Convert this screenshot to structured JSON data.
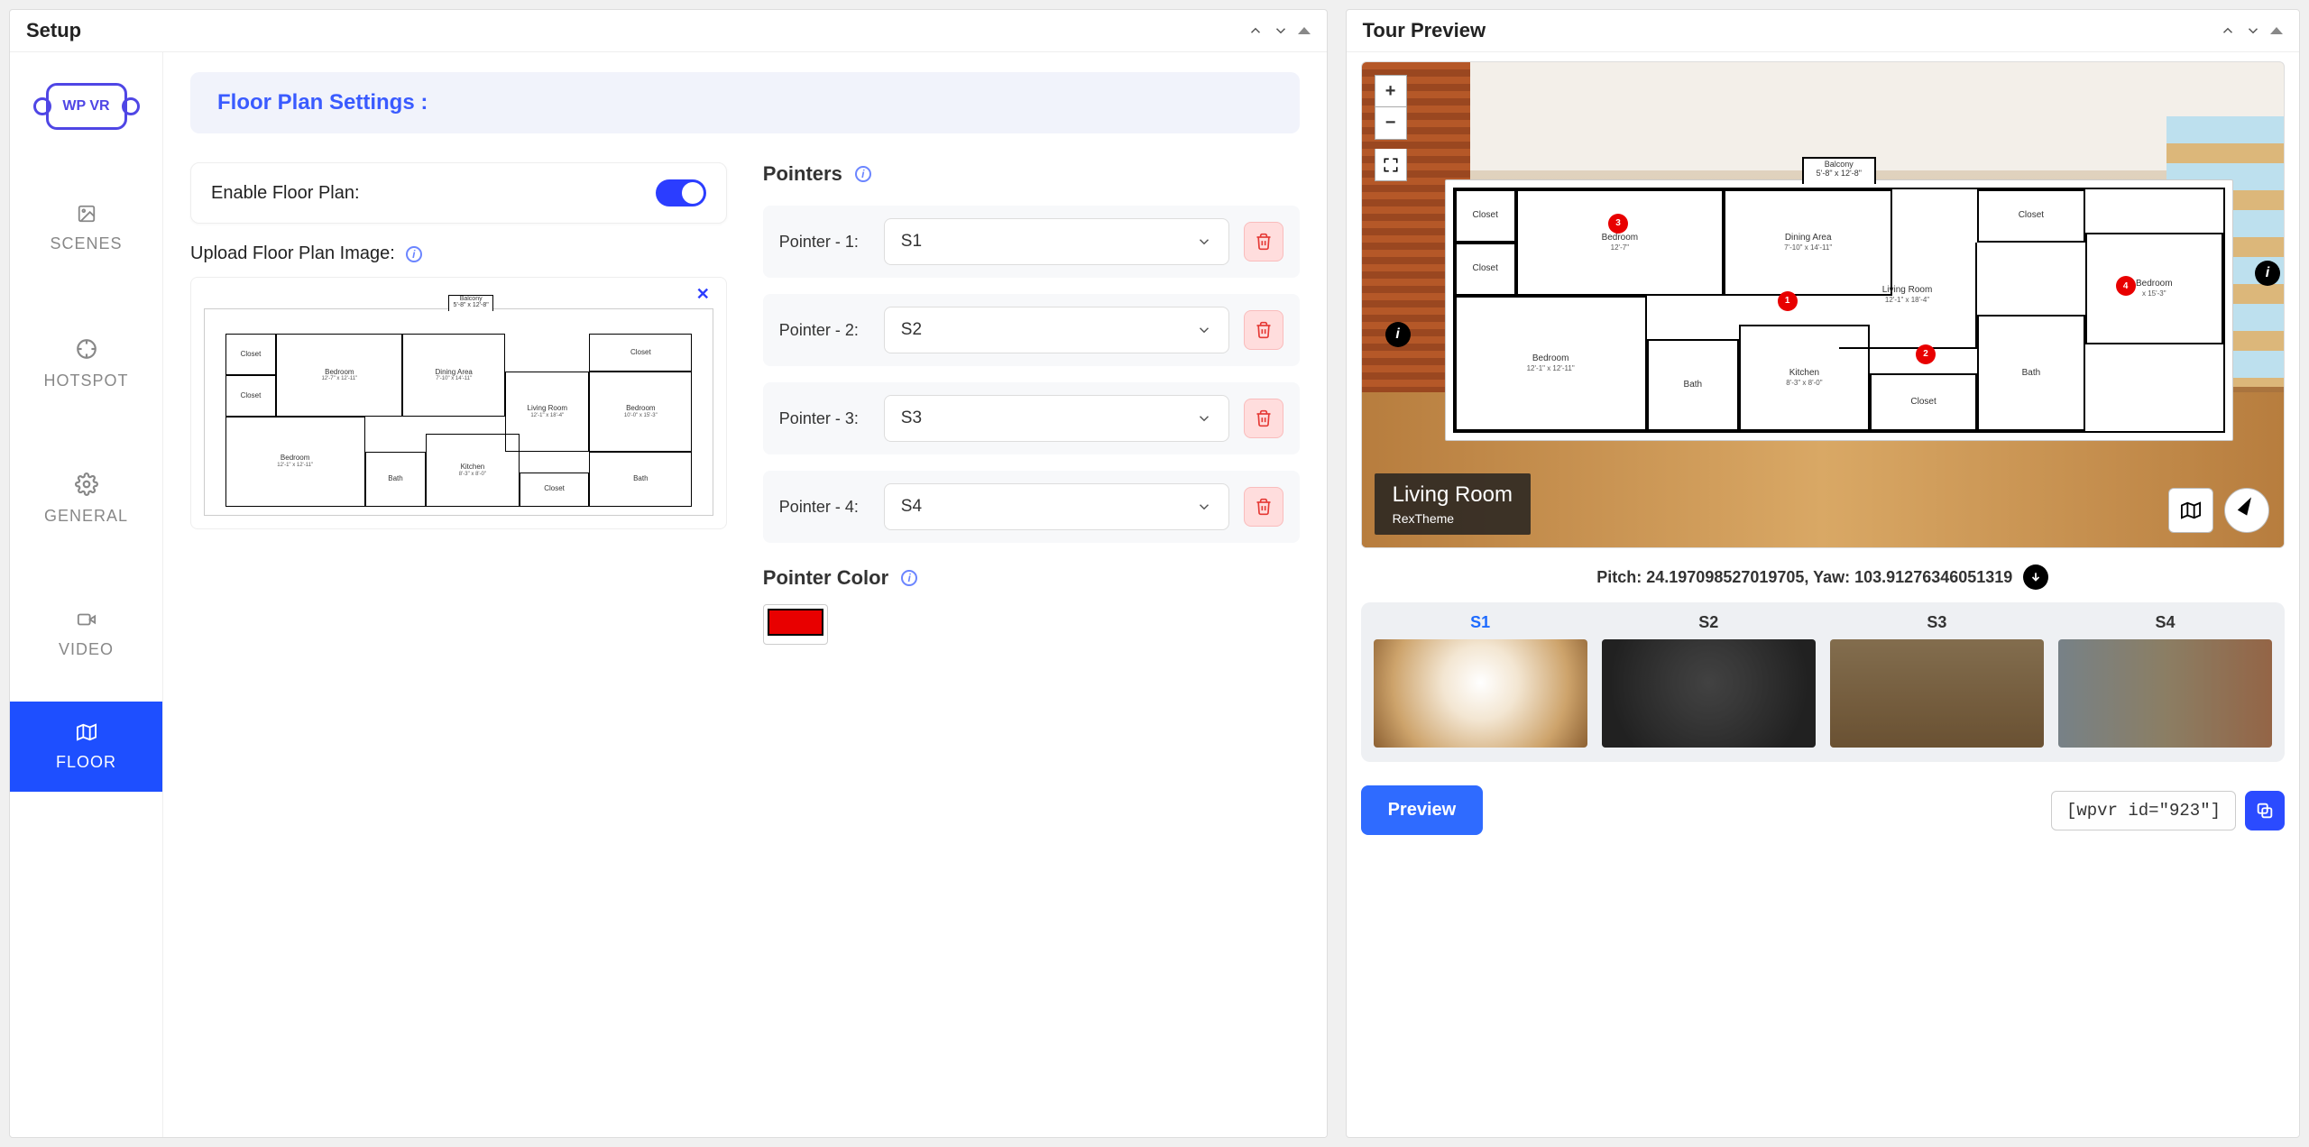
{
  "leftPanel": {
    "title": "Setup"
  },
  "rightPanel": {
    "title": "Tour Preview"
  },
  "logo": "WP VR",
  "nav": {
    "scenes": "SCENES",
    "hotspot": "HOTSPOT",
    "general": "GENERAL",
    "video": "VIDEO",
    "floor": "FLOOR"
  },
  "sectionTitle": "Floor Plan Settings :",
  "enableLabel": "Enable Floor Plan:",
  "uploadLabel": "Upload Floor Plan Image:",
  "pointersTitle": "Pointers",
  "pointers": [
    {
      "label": "Pointer - 1:",
      "value": "S1"
    },
    {
      "label": "Pointer - 2:",
      "value": "S2"
    },
    {
      "label": "Pointer - 3:",
      "value": "S3"
    },
    {
      "label": "Pointer - 4:",
      "value": "S4"
    }
  ],
  "pointerColorLabel": "Pointer Color",
  "pointerColor": "#e80000",
  "floorplanUpload": {
    "balcony": {
      "name": "Balcony",
      "dim": "5'-8\" x 12'-8\""
    },
    "rooms": {
      "closet1": "Closet",
      "closet2": "Closet",
      "bedroomTL": {
        "name": "Bedroom",
        "dim": "12'-7\" x 12'-11\""
      },
      "dining": {
        "name": "Dining Area",
        "dim": "7'-10\" x 14'-11\""
      },
      "living": {
        "name": "Living Room",
        "dim": "12'-1\" x 18'-4\""
      },
      "closetR": "Closet",
      "bedroomR": {
        "name": "Bedroom",
        "dim": "10'-0\" x 15'-3\""
      },
      "bathR": "Bath",
      "bedroomBL": {
        "name": "Bedroom",
        "dim": "12'-1\" x 12'-11\""
      },
      "bathBL": "Bath",
      "kitchen": {
        "name": "Kitchen",
        "dim": "8'-3\" x 8'-0\""
      },
      "closetBR": "Closet"
    }
  },
  "preview": {
    "floorplan": {
      "balcony": {
        "name": "Balcony",
        "dim": "5'-8\" x 12'-8\""
      },
      "rooms": {
        "closet1": "Closet",
        "closet2": "Closet",
        "bedroomTL": {
          "name": "Bedroom",
          "dim": "12'-7\""
        },
        "dining": {
          "name": "Dining Area",
          "dim": "7'-10\" x 14'-11\""
        },
        "living": {
          "name": "Living Room",
          "dim": "12'-1\" x 18'-4\""
        },
        "closetR": "Closet",
        "bedroomR": {
          "name": "Bedroom",
          "dim": "x 15'-3\""
        },
        "bathR": "Bath",
        "bedroomBL": {
          "name": "Bedroom",
          "dim": "12'-1\" x 12'-11\""
        },
        "bathBL": "Bath",
        "kitchen": {
          "name": "Kitchen",
          "dim": "8'-3\" x 8'-0\""
        },
        "closetBR": "Closet"
      },
      "dots": [
        "1",
        "2",
        "3",
        "4"
      ]
    },
    "sceneName": "Living Room",
    "sceneAuthor": "RexTheme",
    "pitchLabel": "Pitch: 24.197098527019705, Yaw: 103.91276346051319",
    "scenes": [
      "S1",
      "S2",
      "S3",
      "S4"
    ],
    "previewBtn": "Preview",
    "shortcode": "[wpvr id=\"923\"]"
  }
}
